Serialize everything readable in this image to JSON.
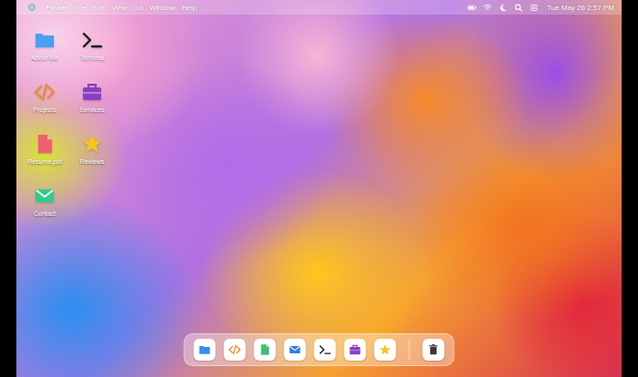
{
  "menu_bar": {
    "app_name": "Finder",
    "menus": [
      "File",
      "Edit",
      "View",
      "Go",
      "Window",
      "Help"
    ],
    "clock": "Tue May 26 2:57 PM"
  },
  "desktop_icons": [
    {
      "label": "About Me",
      "kind": "folder",
      "color": "#4a9ef5"
    },
    {
      "label": "Terminal",
      "kind": "terminal",
      "color": "#1a1a1a"
    },
    {
      "label": "Projects",
      "kind": "code",
      "color": "#f08a24"
    },
    {
      "label": "Services",
      "kind": "briefcase",
      "color": "#8a3fc0"
    },
    {
      "label": "Resume.pdf",
      "kind": "pdf",
      "color": "#f06070"
    },
    {
      "label": "Reviews",
      "kind": "star",
      "color": "#f5c518"
    },
    {
      "label": "Contact",
      "kind": "mail",
      "color": "#2ecc8a"
    }
  ],
  "dock": {
    "apps": [
      {
        "kind": "folder",
        "color": "#3b8cf0"
      },
      {
        "kind": "code",
        "color": "#f08a24"
      },
      {
        "kind": "pdf",
        "color": "#3cbf78"
      },
      {
        "kind": "mail",
        "color": "#2f7de0"
      },
      {
        "kind": "terminal",
        "color": "#1a1a1a"
      },
      {
        "kind": "briefcase",
        "color": "#8a3fc0"
      },
      {
        "kind": "star",
        "color": "#f5c518"
      }
    ],
    "trash": {
      "kind": "trash",
      "color": "#3a3a3a"
    }
  }
}
